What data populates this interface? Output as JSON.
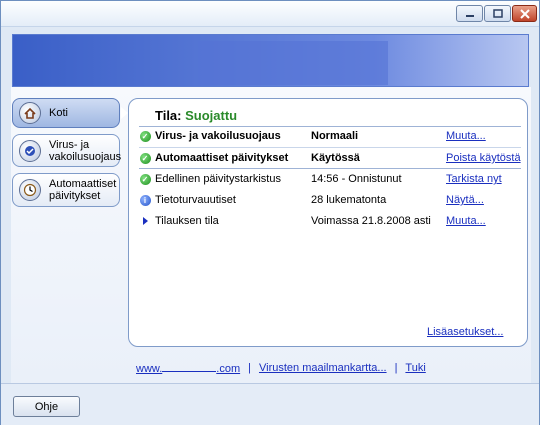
{
  "window": {
    "controls": [
      "minimize",
      "maximize",
      "close"
    ]
  },
  "sidebar": {
    "items": [
      {
        "label": "Koti",
        "icon": "home-icon",
        "active": true
      },
      {
        "label": "Virus- ja vakoilusuojaus",
        "icon": "virus-shield-icon",
        "active": false
      },
      {
        "label": "Automaattiset päivitykset",
        "icon": "clock-icon",
        "active": false
      }
    ]
  },
  "status": {
    "prefix": "Tila:",
    "value": "Suojattu"
  },
  "rows": [
    {
      "icon": "check-icon",
      "name": "Virus- ja vakoilusuojaus",
      "value": "Normaali",
      "action": "Muuta...",
      "bold": true
    },
    {
      "icon": "check-icon",
      "name": "Automaattiset päivitykset",
      "value": "Käytössä",
      "action": "Poista käytöstä",
      "bold": true
    },
    {
      "icon": "check-icon",
      "name": "Edellinen päivitystarkistus",
      "value": "14:56 - Onnistunut",
      "action": "Tarkista nyt",
      "bold": false
    },
    {
      "icon": "info-icon",
      "name": "Tietoturvauutiset",
      "value": "28 lukematonta",
      "action": "Näytä...",
      "bold": false
    },
    {
      "icon": "triangle-icon",
      "name": "Tilauksen tila",
      "value": "Voimassa 21.8.2008 asti",
      "action": "Muuta...",
      "bold": false
    }
  ],
  "more_settings": "Lisäasetukset...",
  "footer": {
    "link1_prefix": "www.",
    "link1_suffix": ".com",
    "link2": "Virusten maailmankartta...",
    "link3": "Tuki",
    "separator": "|"
  },
  "help_button": "Ohje",
  "colors": {
    "accent": "#1a2fbf",
    "ok": "#2a8a2a",
    "banner": "#3a5fc7"
  }
}
